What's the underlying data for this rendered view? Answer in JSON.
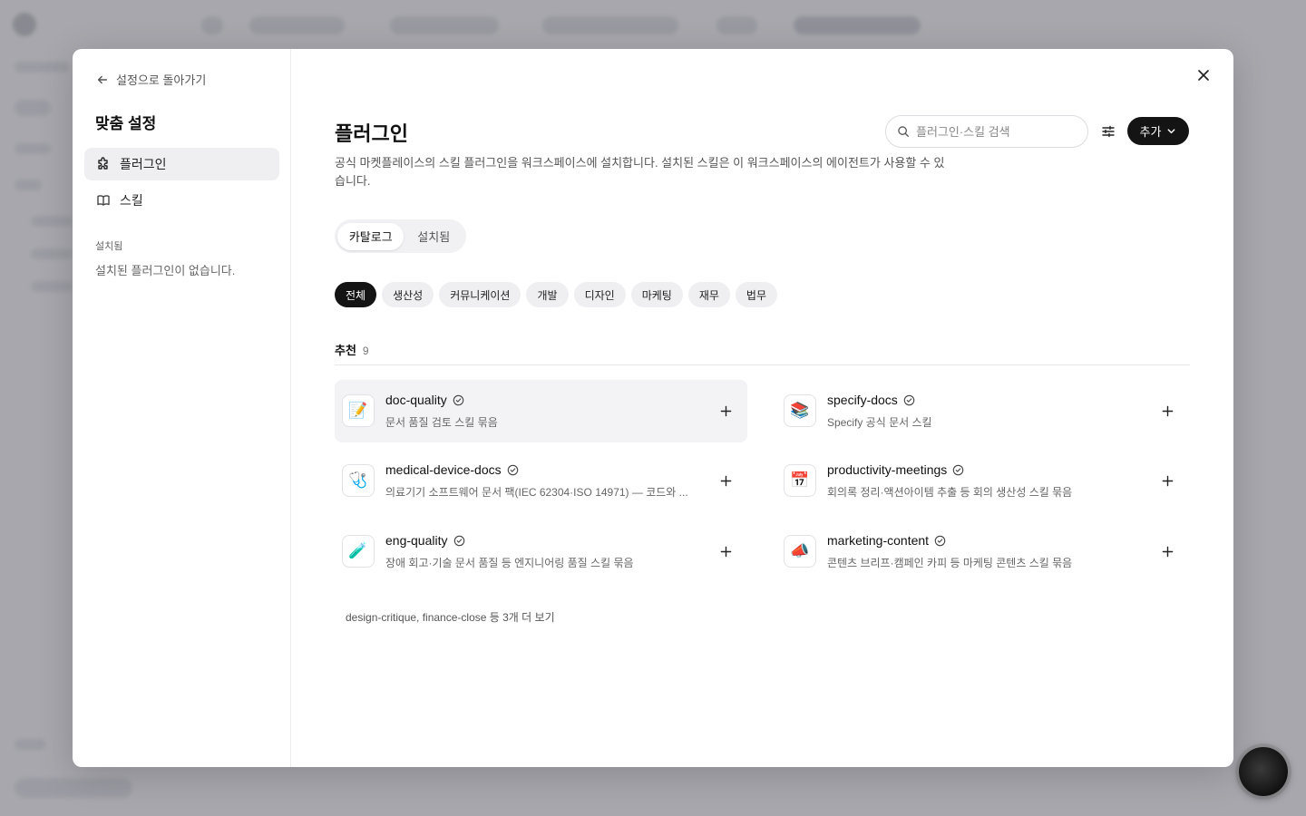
{
  "sidebar": {
    "back_label": "설정으로 돌아가기",
    "title": "맞춤 설정",
    "items": [
      {
        "label": "플러그인",
        "icon": "puzzle-icon"
      },
      {
        "label": "스킬",
        "icon": "book-icon"
      }
    ],
    "installed_label": "설치됨",
    "installed_empty": "설치된 플러그인이 없습니다."
  },
  "main": {
    "title": "플러그인",
    "description": "공식 마켓플레이스의 스킬 플러그인을 워크스페이스에 설치합니다. 설치된 스킬은 이 워크스페이스의 에이전트가 사용할 수 있습니다.",
    "search_placeholder": "플러그인·스킬 검색",
    "add_label": "추가",
    "tabs": [
      {
        "label": "카탈로그"
      },
      {
        "label": "설치됨"
      }
    ],
    "categories": [
      {
        "label": "전체"
      },
      {
        "label": "생산성"
      },
      {
        "label": "커뮤니케이션"
      },
      {
        "label": "개발"
      },
      {
        "label": "디자인"
      },
      {
        "label": "마케팅"
      },
      {
        "label": "재무"
      },
      {
        "label": "법무"
      }
    ],
    "section": {
      "label": "추천",
      "count": "9"
    },
    "plugins": [
      {
        "name": "doc-quality",
        "desc": "문서 품질 검토 스킬 묶음",
        "emoji": "📝"
      },
      {
        "name": "specify-docs",
        "desc": "Specify 공식 문서 스킬",
        "emoji": "📚"
      },
      {
        "name": "medical-device-docs",
        "desc": "의료기기 소프트웨어 문서 팩(IEC 62304·ISO 14971) — 코드와 ...",
        "emoji": "🩺"
      },
      {
        "name": "productivity-meetings",
        "desc": "회의록 정리·액션아이템 추출 등 회의 생산성 스킬 묶음",
        "emoji": "📅"
      },
      {
        "name": "eng-quality",
        "desc": "장애 회고·기술 문서 품질 등 엔지니어링 품질 스킬 묶음",
        "emoji": "🧪"
      },
      {
        "name": "marketing-content",
        "desc": "콘텐츠 브리프·캠페인 카피 등 마케팅 콘텐츠 스킬 묶음",
        "emoji": "📣"
      }
    ],
    "more_label": "design-critique, finance-close 등 3개 더 보기"
  }
}
